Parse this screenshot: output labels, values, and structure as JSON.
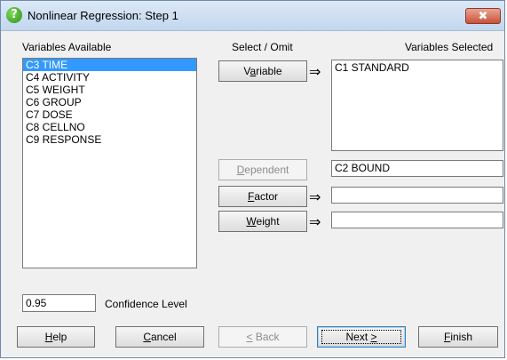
{
  "window": {
    "title": "Nonlinear Regression: Step 1",
    "close_glyph": "✖",
    "help_glyph": "?"
  },
  "labels": {
    "variables_available": "Variables Available",
    "select_omit": "Select / Omit",
    "variables_selected": "Variables Selected",
    "confidence_level": "Confidence Level"
  },
  "variables_available": [
    {
      "label": "C3 TIME",
      "selected": true
    },
    {
      "label": "C4 ACTIVITY",
      "selected": false
    },
    {
      "label": "C5 WEIGHT",
      "selected": false
    },
    {
      "label": "C6 GROUP",
      "selected": false
    },
    {
      "label": "C7 DOSE",
      "selected": false
    },
    {
      "label": "C8 CELLNO",
      "selected": false
    },
    {
      "label": "C9 RESPONSE",
      "selected": false
    }
  ],
  "buttons": {
    "variable": {
      "mnemonic": "a",
      "before": "V",
      "after": "riable"
    },
    "dependent": {
      "mnemonic": "D",
      "before": "",
      "after": "ependent"
    },
    "factor": {
      "mnemonic": "F",
      "before": "",
      "after": "actor"
    },
    "weight": {
      "mnemonic": "W",
      "before": "",
      "after": "eight"
    },
    "help": {
      "mnemonic": "H",
      "before": "",
      "after": "elp"
    },
    "cancel": {
      "mnemonic": "C",
      "before": "",
      "after": "ancel"
    },
    "back": {
      "mnemonic": "<",
      "before": "",
      "after": " Back"
    },
    "next": {
      "mnemonic": ">",
      "before": "Next ",
      "after": ""
    },
    "finish": {
      "mnemonic": "F",
      "before": "",
      "after": "inish"
    }
  },
  "arrow_glyph": "⇒",
  "fields": {
    "variable_selected": "C1 STANDARD",
    "dependent": "C2 BOUND",
    "factor": "",
    "weight": "",
    "confidence_level": "0.95"
  }
}
